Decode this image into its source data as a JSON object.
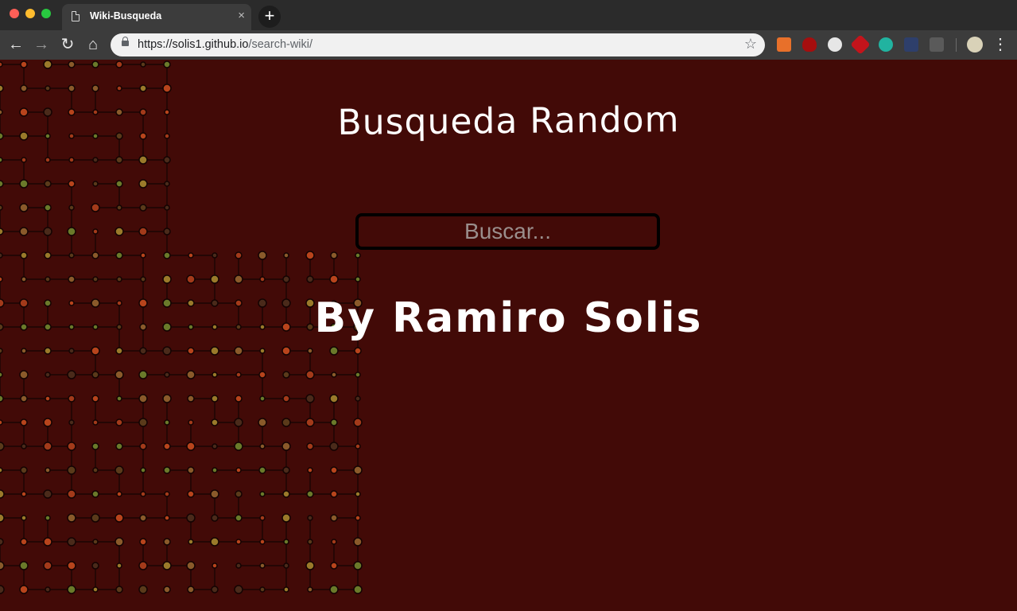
{
  "browser": {
    "tab_title": "Wiki-Busqueda",
    "tab_close": "×",
    "new_tab": "+",
    "url_host": "https://solis1.github.io",
    "url_path": "/search-wiki/",
    "back": "←",
    "forward": "→",
    "reload": "↻",
    "home": "⌂",
    "bookmark": "☆",
    "menu": "⋮"
  },
  "page": {
    "title": "Busqueda Random",
    "search_placeholder": "Buscar...",
    "byline": "By Ramiro Solis"
  },
  "colors": {
    "background": "#420a07",
    "text": "#ffffff",
    "search_border": "#000000",
    "placeholder": "#9a8e8c"
  }
}
